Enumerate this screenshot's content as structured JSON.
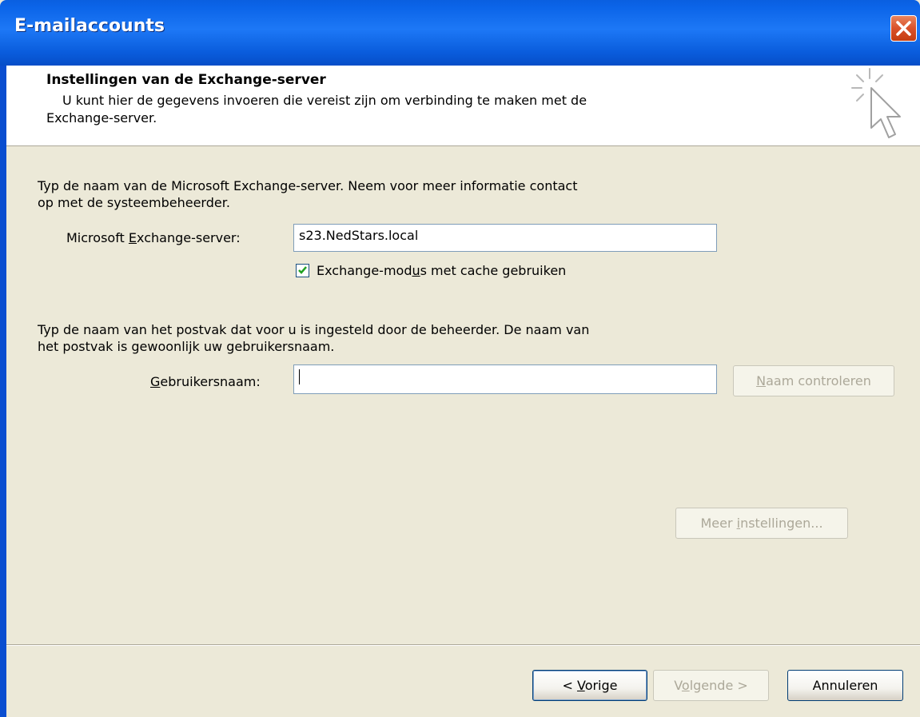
{
  "window": {
    "title": "E-mailaccounts"
  },
  "header": {
    "title": "Instellingen van de Exchange-server",
    "subtitle_line1": "U kunt hier de gegevens invoeren die vereist zijn om verbinding te maken met de",
    "subtitle_line2": "Exchange-server."
  },
  "server_section": {
    "intro_line1": "Typ de naam van de Microsoft Exchange-server. Neem voor meer informatie contact",
    "intro_line2": "op met de systeembeheerder.",
    "label_pre": "Microsoft ",
    "label_key": "E",
    "label_post": "xchange-server:",
    "value": "s23.NedStars.local",
    "cache_pre": "Exchange-mod",
    "cache_key": "u",
    "cache_post": "s met cache gebruiken",
    "cache_checked": true
  },
  "mailbox_section": {
    "intro_line1": "Typ de naam van het postvak dat voor u is ingesteld door de beheerder. De naam van",
    "intro_line2": "het postvak is gewoonlijk uw gebruikersnaam.",
    "label_key": "G",
    "label_post": "ebruikersnaam:",
    "value": "",
    "check_key": "N",
    "check_post": "aam controleren"
  },
  "more_settings": {
    "pre": "Meer ",
    "key": "i",
    "post": "nstellingen..."
  },
  "footer": {
    "back_pre": "< ",
    "back_key": "V",
    "back_post": "orige",
    "next_pre": "V",
    "next_key": "o",
    "next_post": "lgende >",
    "cancel": "Annuleren"
  },
  "colors": {
    "title_bar": "#0b64e8",
    "dialog_bg": "#ece9d8",
    "close_button": "#d9512a",
    "checkmark": "#21a121"
  }
}
